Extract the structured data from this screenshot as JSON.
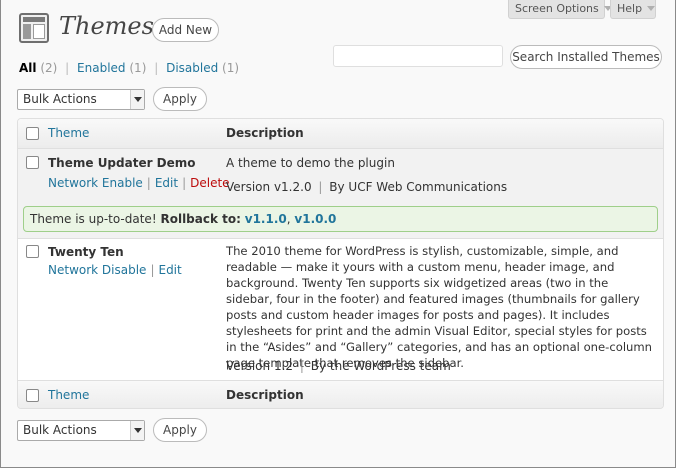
{
  "screen_meta": {
    "screen_options": "Screen Options",
    "help": "Help"
  },
  "header": {
    "title": "Themes",
    "add_new": "Add New"
  },
  "filters": [
    {
      "label": "All",
      "count": "(2)"
    },
    {
      "label": "Enabled",
      "count": "(1)"
    },
    {
      "label": "Disabled",
      "count": "(1)"
    }
  ],
  "search": {
    "button": "Search Installed Themes",
    "value": ""
  },
  "bulk": {
    "select_top": "Bulk Actions",
    "apply_top": "Apply",
    "select_bottom": "Bulk Actions",
    "apply_bottom": "Apply"
  },
  "table": {
    "col_theme": "Theme",
    "col_description": "Description",
    "rows": [
      {
        "name": "Theme Updater Demo",
        "actions": [
          "Network Enable",
          "Edit",
          "Delete"
        ],
        "description": "A theme to demo the plugin",
        "version": "Version v1.2.0",
        "by": "By UCF Web Communications"
      },
      {
        "name": "Twenty Ten",
        "actions": [
          "Network Disable",
          "Edit"
        ],
        "description": "The 2010 theme for WordPress is stylish, customizable, simple, and readable — make it yours with a custom menu, header image, and background. Twenty Ten supports six widgetized areas (two in the sidebar, four in the footer) and featured images (thumbnails for gallery posts and custom header images for posts and pages). It includes stylesheets for print and the admin Visual Editor, special styles for posts in the “Asides” and “Gallery” categories, and has an optional one-column page template that removes the sidebar.",
        "version": "Version 1.2",
        "by": "By the WordPress team"
      }
    ],
    "notice": {
      "text": "Theme is up-to-date!",
      "rollback_label": "Rollback to:",
      "links": [
        "v1.1.0",
        "v1.0.0"
      ]
    }
  },
  "colors": {
    "link": "#21759b",
    "delete": "#bc0b0b",
    "notice_bg": "#ebf5e5",
    "notice_border": "#9fcf8a"
  }
}
